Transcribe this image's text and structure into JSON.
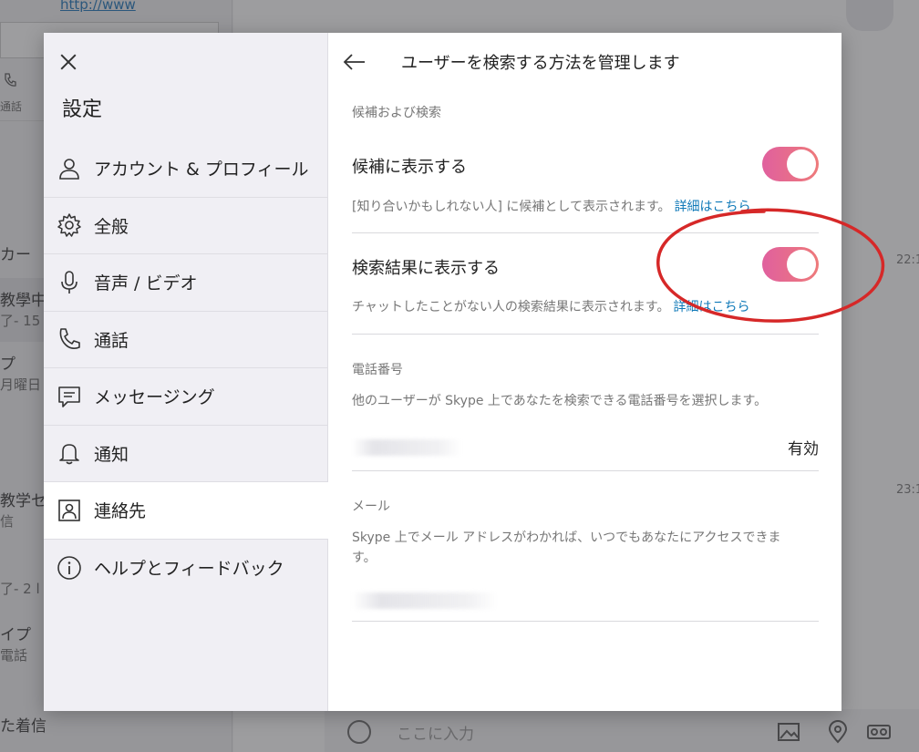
{
  "background": {
    "top_link": "http://www",
    "call_label": "通話",
    "left_list": [
      {
        "text": "カー"
      },
      {
        "text": "教學中",
        "sub": "了- 15"
      },
      {
        "text": "プ",
        "sub": "月曜日"
      },
      {
        "text": "教学セ",
        "sub": "信"
      },
      {
        "text": "了- 2 l"
      },
      {
        "text": "イプ",
        "sub": "電話"
      },
      {
        "text": "た着信"
      }
    ],
    "times": [
      "22:1",
      "23:1"
    ],
    "input_placeholder": "ここに入力"
  },
  "settings": {
    "title": "設定",
    "nav_items": [
      {
        "label": "アカウント & プロフィール",
        "icon": "person-icon"
      },
      {
        "label": "全般",
        "icon": "gear-icon"
      },
      {
        "label": "音声 / ビデオ",
        "icon": "microphone-icon"
      },
      {
        "label": "通話",
        "icon": "phone-icon"
      },
      {
        "label": "メッセージング",
        "icon": "message-icon"
      },
      {
        "label": "通知",
        "icon": "bell-icon"
      },
      {
        "label": "連絡先",
        "icon": "contacts-icon"
      },
      {
        "label": "ヘルプとフィードバック",
        "icon": "info-icon"
      }
    ],
    "active_index": 6
  },
  "panel": {
    "title": "ユーザーを検索する方法を管理します",
    "section1_label": "候補および検索",
    "suggestions": {
      "title": "候補に表示する",
      "desc": "[知り合いかもしれない人] に候補として表示されます。",
      "link": "詳細はこちら",
      "enabled": true
    },
    "search_results": {
      "title": "検索結果に表示する",
      "desc": "チャットしたことがない人の検索結果に表示されます。",
      "link": "詳細はこちら",
      "enabled": true
    },
    "phone": {
      "label": "電話番号",
      "desc": "他のユーザーが Skype 上であなたを検索できる電話番号を選択します。",
      "status": "有効"
    },
    "email": {
      "label": "メール",
      "desc_line1": "Skype 上でメール アドレスがわかれば、いつでもあなたにアクセスできま",
      "desc_line2": "す。"
    }
  },
  "colors": {
    "toggle_start": "#e0609e",
    "toggle_end": "#ee7a7a",
    "link": "#0f79b8",
    "annotation": "#d62828"
  }
}
